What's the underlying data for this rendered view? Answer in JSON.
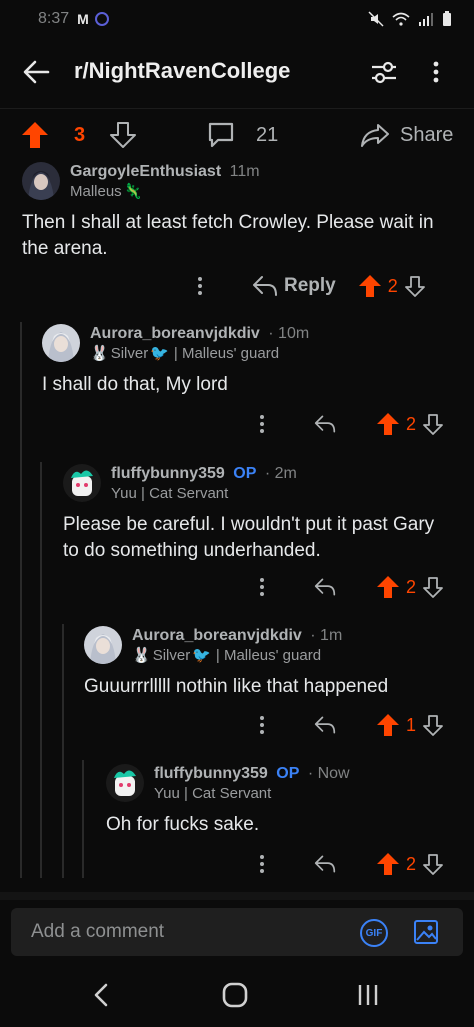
{
  "status_bar": {
    "time": "8:37",
    "app_icon": "M"
  },
  "header": {
    "title": "r/NightRavenCollege",
    "back_icon": "arrow-left-icon",
    "filter_icon": "sliders-icon",
    "more_icon": "more-vertical-icon"
  },
  "post_bar": {
    "score": "3",
    "comments": "21",
    "share_label": "Share"
  },
  "comments": [
    {
      "author": "GargoyleEnthusiast",
      "op": "",
      "time": "11m",
      "flair": "Malleus",
      "flair_emoji": "🦎",
      "body": "Then I shall at least fetch Crowley. Please wait in the arena.",
      "score": "2",
      "reply_label": "Reply"
    },
    {
      "author": "Aurora_boreanvjdkdiv",
      "op": "",
      "time": "· 10m",
      "flair_pre": "🐰",
      "flair": "Silver",
      "flair_emoji": "🐦",
      "flair_post": "| Malleus' guard",
      "body": "I shall do that, My lord",
      "score": "2"
    },
    {
      "author": "fluffybunny359",
      "op": "OP",
      "time": "· 2m",
      "flair": "Yuu | Cat Servant",
      "body": "Please be careful. I wouldn't put it past Gary to do something underhanded.",
      "score": "2"
    },
    {
      "author": "Aurora_boreanvjdkdiv",
      "op": "",
      "time": "· 1m",
      "flair_pre": "🐰",
      "flair": "Silver",
      "flair_emoji": "🐦",
      "flair_post": "| Malleus' guard",
      "body": "Guuurrrlllll nothin like that happened",
      "score": "1"
    },
    {
      "author": "fluffybunny359",
      "op": "OP",
      "time": "· Now",
      "flair": "Yuu | Cat Servant",
      "body": "Oh for fucks sake.",
      "score": "2"
    }
  ],
  "comment_box": {
    "placeholder": "Add a comment",
    "gif_label": "GIF"
  },
  "colors": {
    "upvote": "#ff4500",
    "op": "#3b82f6",
    "background": "#0b0b0b"
  }
}
